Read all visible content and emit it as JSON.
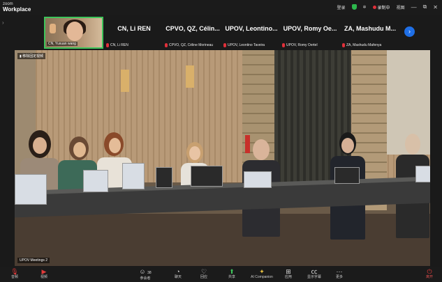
{
  "app": {
    "logo_line1": "zoom",
    "logo_line2": "Workplace"
  },
  "titlebar": {
    "signin": "登录",
    "recording": "录制中",
    "view": "视图",
    "minimize": "—",
    "restore": "⧉",
    "close": "✕"
  },
  "self_view": {
    "name": "CN, Yuxuan wang"
  },
  "participants": [
    {
      "display": "CN, Li REN",
      "name": "CN, Li REN"
    },
    {
      "display": "CPVO, QZ, Célin...",
      "name": "CPVO, QZ, Céline Morineau"
    },
    {
      "display": "UPOV, Leontino...",
      "name": "UPOV, Leontino Taveira"
    },
    {
      "display": "UPOV, Romy Oe...",
      "name": "UPOV, Romy Oertel"
    },
    {
      "display": "ZA, Mashudu M...",
      "name": "ZA, Mashudu Mafenya"
    }
  ],
  "stage": {
    "label": "▮ 移除固定视频",
    "speaker_name": "UPOV Meetings 2"
  },
  "toolbar": {
    "audio": "音频",
    "video": "视频",
    "participants": "参会者",
    "participant_count": "38",
    "chat": "聊天",
    "react": "回应",
    "share": "共享",
    "ai_companion": "AI Companion",
    "apps": "应用",
    "captions": "显示字幕",
    "more": "更多",
    "leave": "离开"
  },
  "icons": {
    "mic": "mic-off-icon",
    "cam": "camera-off-icon",
    "people": "people-icon",
    "chat": "chat-icon",
    "heart": "heart-icon",
    "share": "share-icon",
    "ai": "sparkle-icon",
    "apps": "apps-icon",
    "cc": "cc-icon",
    "more": "more-icon",
    "leave": "leave-icon",
    "shield": "shield-icon",
    "next": "chevron-right-icon"
  },
  "colors": {
    "accent_green": "#3ec45a",
    "record_red": "#e0303a",
    "next_blue": "#1f6fe6"
  }
}
